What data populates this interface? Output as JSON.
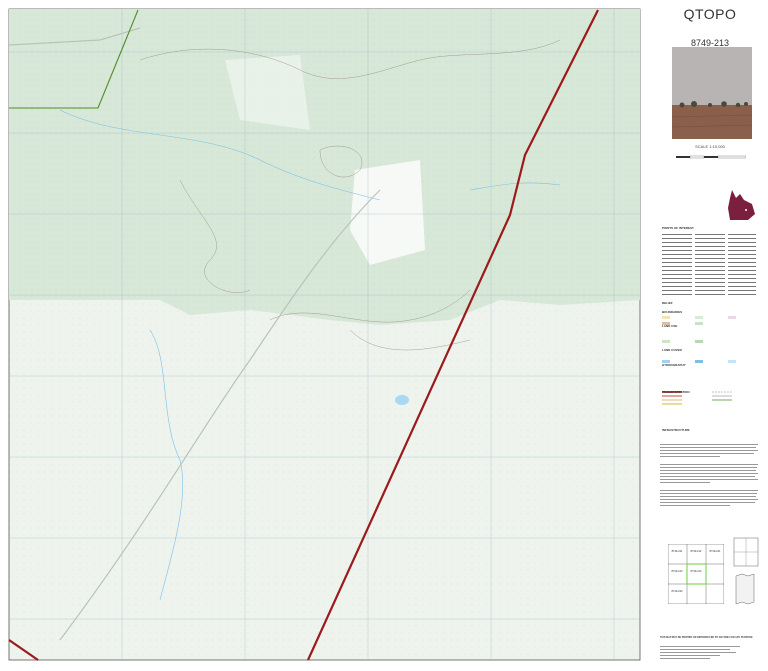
{
  "panel": {
    "brand": "QTOPO",
    "sheet_number": "8749-213",
    "scale": "SCALE 1:10,000",
    "legend_heading": "POINTS OF INTEREST",
    "legend_sections": [
      "RELIEF",
      "BOUNDARIES",
      "LAND USE",
      "LAND COVER",
      "HYDROGRAPHY",
      "TRANSPORTATION",
      "INFRASTRUCTURE"
    ],
    "adjoining_sheets": [
      "8749-211",
      "8749-212",
      "8749-213",
      "8749-214",
      "8749-221",
      "8749-222"
    ],
    "public_right_of_way": "THIS MAP MAY BE PRINTED OR REPRODUCED BY ANYONE FOR ANY PURPOSE"
  },
  "colors": {
    "vegetation": "#d9ead9",
    "clear": "#f4f7f4",
    "road": "#9b1b1b",
    "boundary": "#4f8a2a",
    "qld_maroon": "#7a1f3d",
    "contour": "#8a7a6a",
    "water": "#9fd3ef"
  }
}
